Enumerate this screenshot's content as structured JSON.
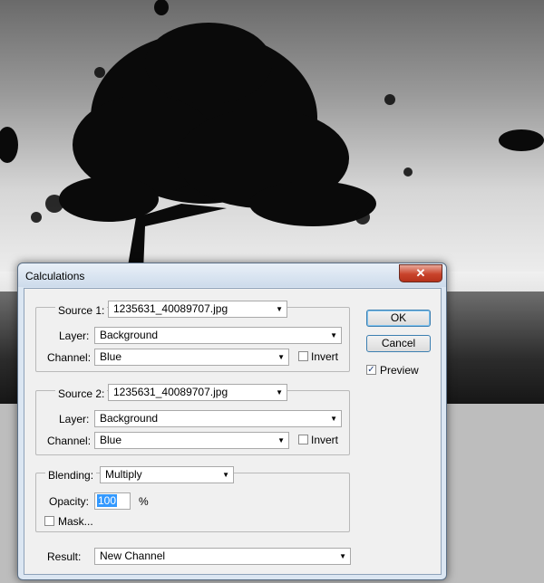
{
  "dialog": {
    "title": "Calculations",
    "close_symbol": "✕",
    "source1": {
      "label": "Source 1:",
      "file": "1235631_40089707.jpg",
      "layer_label": "Layer:",
      "layer": "Background",
      "channel_label": "Channel:",
      "channel": "Blue",
      "invert_label": "Invert",
      "invert_checked": false
    },
    "source2": {
      "label": "Source 2:",
      "file": "1235631_40089707.jpg",
      "layer_label": "Layer:",
      "layer": "Background",
      "channel_label": "Channel:",
      "channel": "Blue",
      "invert_label": "Invert",
      "invert_checked": false
    },
    "blending": {
      "label": "Blending:",
      "mode": "Multiply",
      "opacity_label": "Opacity:",
      "opacity_value": "100",
      "percent": "%",
      "mask_label": "Mask...",
      "mask_checked": false
    },
    "result": {
      "label": "Result:",
      "value": "New Channel"
    },
    "buttons": {
      "ok": "OK",
      "cancel": "Cancel",
      "preview_label": "Preview",
      "preview_checked": true,
      "check_mark": "✓"
    }
  },
  "icons": {
    "dropdown": "▼",
    "dropdown_small": "▾"
  },
  "colors": {
    "dialog_frame": "#dbe6f2",
    "close_button": "#c9432b",
    "selection": "#3399ff"
  }
}
